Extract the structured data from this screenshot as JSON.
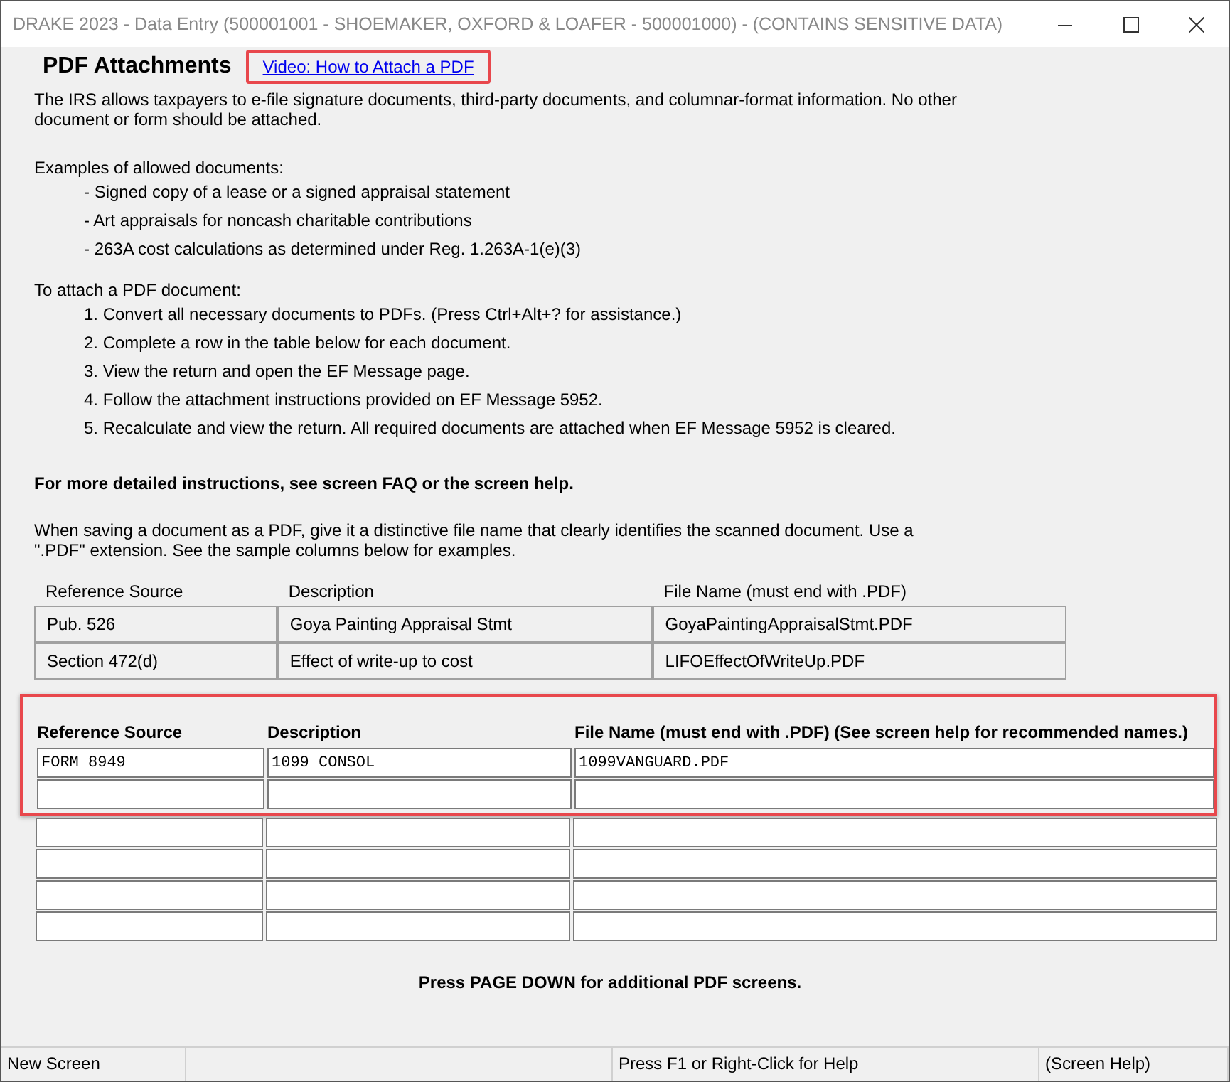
{
  "window": {
    "title": "DRAKE 2023 - Data Entry (500001001 - SHOEMAKER, OXFORD & LOAFER - 500001000) - (CONTAINS SENSITIVE DATA)"
  },
  "heading": "PDF Attachments",
  "video_link": "Video: How to Attach a PDF",
  "intro": "The IRS allows taxpayers to e-file signature documents, third-party documents, and columnar-format information.  No other document or form should be attached.",
  "examples_heading": "Examples of allowed documents:",
  "examples": [
    "- Signed copy of a lease or a signed appraisal statement",
    "- Art appraisals for noncash charitable contributions",
    "- 263A cost calculations as determined under Reg. 1.263A-1(e)(3)"
  ],
  "steps_heading": "To attach a PDF document:",
  "steps": [
    "1. Convert all necessary documents to PDFs. (Press Ctrl+Alt+? for assistance.)",
    "2. Complete a row in the table below for each document.",
    "3. View the return and open the EF Message page.",
    "4. Follow the attachment instructions provided on EF Message 5952.",
    "5. Recalculate and view the return. All required documents are attached when EF Message 5952 is cleared."
  ],
  "more_info": "For more detailed instructions, see screen FAQ or the screen help.",
  "naming_note": "When saving a document as a PDF, give it a distinctive file name that clearly identifies the scanned document.  Use a \".PDF\" extension. See the sample columns below for examples.",
  "sample_table": {
    "columns": [
      "Reference Source",
      "Description",
      "File Name (must end with .PDF)"
    ],
    "rows": [
      [
        "Pub. 526",
        "Goya Painting Appraisal Stmt",
        "GoyaPaintingAppraisalStmt.PDF"
      ],
      [
        "Section 472(d)",
        "Effect of write-up to cost",
        "LIFOEffectOfWriteUp.PDF"
      ]
    ]
  },
  "entry_table": {
    "columns": [
      "Reference Source",
      "Description",
      "File Name (must end with .PDF) (See screen help for recommended names.)"
    ],
    "rows": [
      [
        "FORM 8949",
        "1099 CONSOL",
        "1099VANGUARD.PDF"
      ],
      [
        "",
        "",
        ""
      ],
      [
        "",
        "",
        ""
      ],
      [
        "",
        "",
        ""
      ],
      [
        "",
        "",
        ""
      ],
      [
        "",
        "",
        ""
      ]
    ]
  },
  "page_down_note": "Press PAGE DOWN for additional PDF screens.",
  "status_bar": [
    "New Screen",
    "Press F1 or Right-Click for Help",
    "(Screen Help)"
  ]
}
